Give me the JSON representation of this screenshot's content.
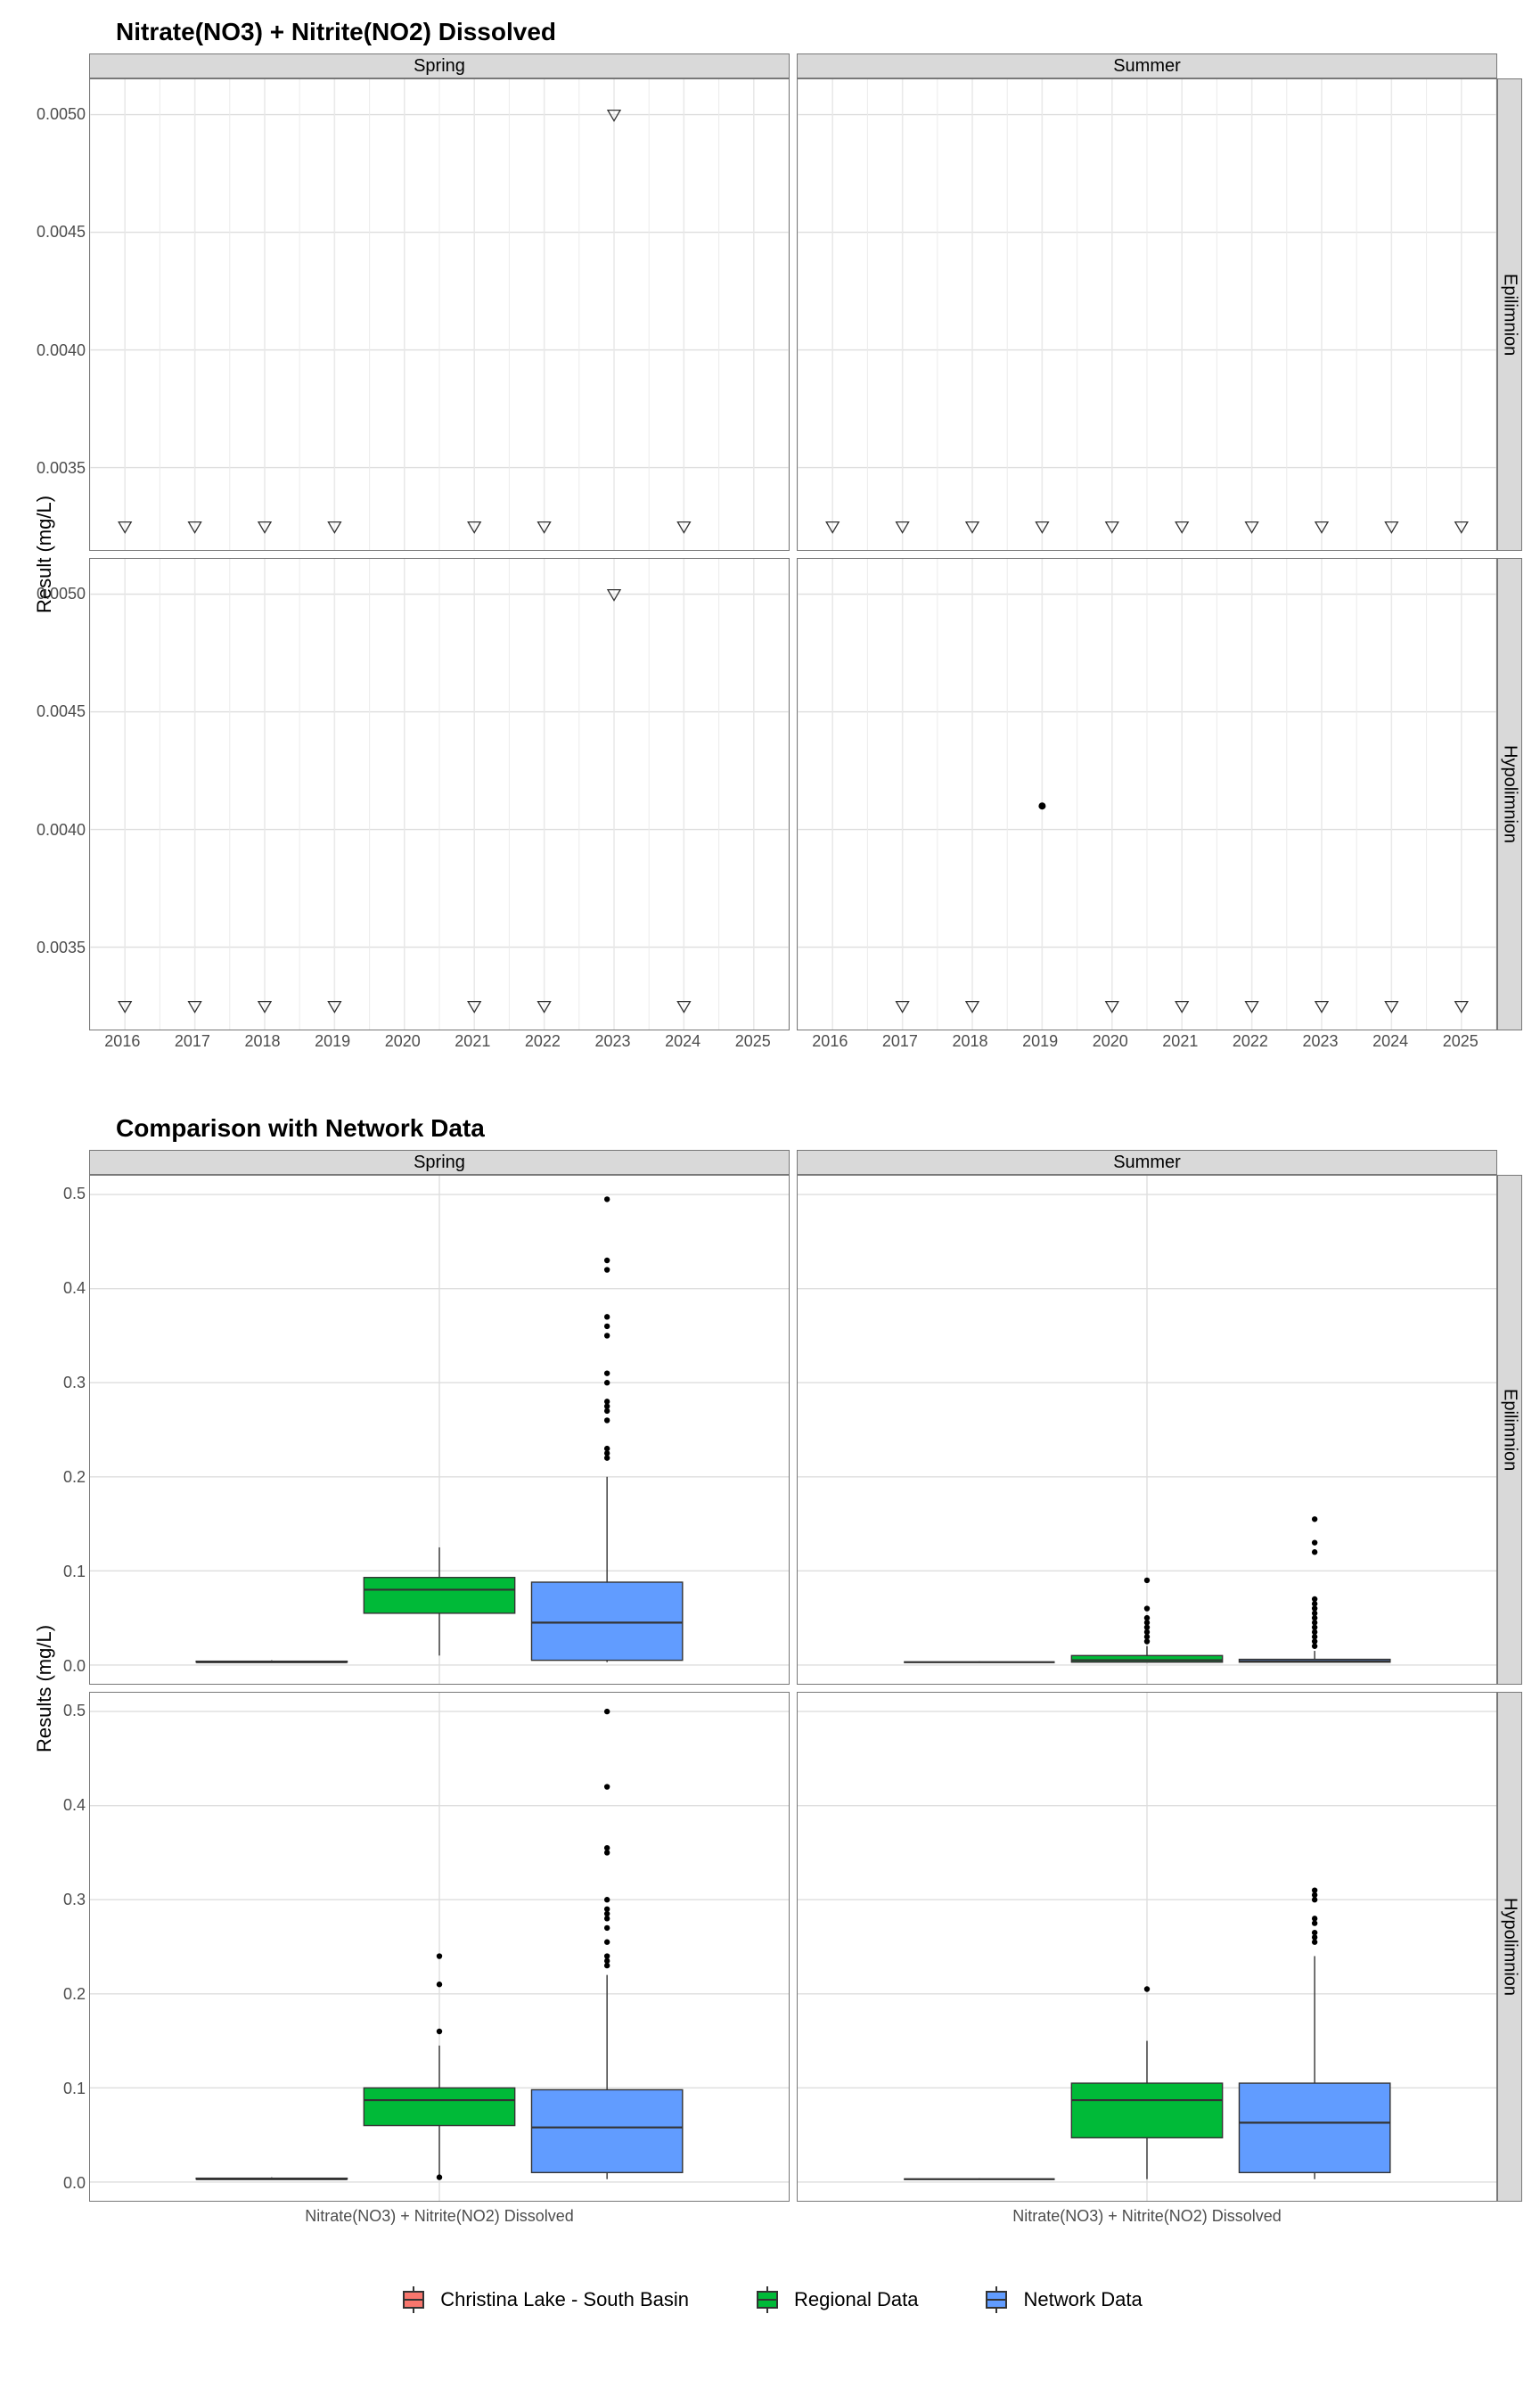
{
  "chart1": {
    "title": "Nitrate(NO3) + Nitrite(NO2) Dissolved",
    "ylab": "Result (mg/L)",
    "col_facets": [
      "Spring",
      "Summer"
    ],
    "row_facets": [
      "Epilimnion",
      "Hypolimnion"
    ],
    "x_ticks": [
      2016,
      2017,
      2018,
      2019,
      2020,
      2021,
      2022,
      2023,
      2024,
      2025
    ],
    "y_ticks": [
      0.0035,
      0.004,
      0.0045,
      0.005
    ],
    "ylim": [
      0.00315,
      0.00515
    ]
  },
  "chart2": {
    "title": "Comparison with Network Data",
    "ylab": "Results (mg/L)",
    "col_facets": [
      "Spring",
      "Summer"
    ],
    "row_facets": [
      "Epilimnion",
      "Hypolimnion"
    ],
    "y_ticks": [
      0.0,
      0.1,
      0.2,
      0.3,
      0.4,
      0.5
    ],
    "ylim": [
      -0.02,
      0.52
    ],
    "x_category": "Nitrate(NO3) + Nitrite(NO2) Dissolved"
  },
  "legend": {
    "items": [
      {
        "label": "Christina Lake - South Basin",
        "color": "#F8766D"
      },
      {
        "label": "Regional Data",
        "color": "#00BA38"
      },
      {
        "label": "Network Data",
        "color": "#619CFF"
      }
    ]
  },
  "chart_data": [
    {
      "type": "scatter",
      "title": "Nitrate(NO3) + Nitrite(NO2) Dissolved",
      "xlabel": "",
      "ylabel": "Result (mg/L)",
      "facets": {
        "columns": [
          "Spring",
          "Summer"
        ],
        "rows": [
          "Epilimnion",
          "Hypolimnion"
        ]
      },
      "ylim": [
        0.00315,
        0.00515
      ],
      "xlim": [
        2015.5,
        2025.5
      ],
      "panels": {
        "Spring|Epilimnion": {
          "censored_points": [
            {
              "x": 2016,
              "y": 0.00325
            },
            {
              "x": 2017,
              "y": 0.00325
            },
            {
              "x": 2018,
              "y": 0.00325
            },
            {
              "x": 2019,
              "y": 0.00325
            },
            {
              "x": 2021,
              "y": 0.00325
            },
            {
              "x": 2022,
              "y": 0.00325
            },
            {
              "x": 2023,
              "y": 0.005
            },
            {
              "x": 2024,
              "y": 0.00325
            }
          ],
          "points": []
        },
        "Summer|Epilimnion": {
          "censored_points": [
            {
              "x": 2016,
              "y": 0.00325
            },
            {
              "x": 2017,
              "y": 0.00325
            },
            {
              "x": 2018,
              "y": 0.00325
            },
            {
              "x": 2019,
              "y": 0.00325
            },
            {
              "x": 2020,
              "y": 0.00325
            },
            {
              "x": 2021,
              "y": 0.00325
            },
            {
              "x": 2022,
              "y": 0.00325
            },
            {
              "x": 2023,
              "y": 0.00325
            },
            {
              "x": 2024,
              "y": 0.00325
            },
            {
              "x": 2025,
              "y": 0.00325
            }
          ],
          "points": []
        },
        "Spring|Hypolimnion": {
          "censored_points": [
            {
              "x": 2016,
              "y": 0.00325
            },
            {
              "x": 2017,
              "y": 0.00325
            },
            {
              "x": 2018,
              "y": 0.00325
            },
            {
              "x": 2019,
              "y": 0.00325
            },
            {
              "x": 2021,
              "y": 0.00325
            },
            {
              "x": 2022,
              "y": 0.00325
            },
            {
              "x": 2023,
              "y": 0.005
            },
            {
              "x": 2024,
              "y": 0.00325
            }
          ],
          "points": []
        },
        "Summer|Hypolimnion": {
          "censored_points": [
            {
              "x": 2017,
              "y": 0.00325
            },
            {
              "x": 2018,
              "y": 0.00325
            },
            {
              "x": 2020,
              "y": 0.00325
            },
            {
              "x": 2021,
              "y": 0.00325
            },
            {
              "x": 2022,
              "y": 0.00325
            },
            {
              "x": 2023,
              "y": 0.00325
            },
            {
              "x": 2024,
              "y": 0.00325
            },
            {
              "x": 2025,
              "y": 0.00325
            }
          ],
          "points": [
            {
              "x": 2019,
              "y": 0.0041
            }
          ]
        }
      }
    },
    {
      "type": "box",
      "title": "Comparison with Network Data",
      "xlabel": "",
      "ylabel": "Results (mg/L)",
      "facets": {
        "columns": [
          "Spring",
          "Summer"
        ],
        "rows": [
          "Epilimnion",
          "Hypolimnion"
        ]
      },
      "ylim": [
        -0.02,
        0.52
      ],
      "x_categories": [
        "Nitrate(NO3) + Nitrite(NO2) Dissolved"
      ],
      "series_colors": {
        "Christina Lake - South Basin": "#F8766D",
        "Regional Data": "#00BA38",
        "Network Data": "#619CFF"
      },
      "panels": {
        "Spring|Epilimnion": {
          "boxes": [
            {
              "series": "Christina Lake - South Basin",
              "min": 0.003,
              "q1": 0.003,
              "median": 0.003,
              "q3": 0.004,
              "max": 0.005,
              "outliers": []
            },
            {
              "series": "Regional Data",
              "min": 0.01,
              "q1": 0.055,
              "median": 0.08,
              "q3": 0.093,
              "max": 0.125,
              "outliers": []
            },
            {
              "series": "Network Data",
              "min": 0.003,
              "q1": 0.005,
              "median": 0.045,
              "q3": 0.088,
              "max": 0.2,
              "outliers": [
                0.22,
                0.225,
                0.23,
                0.26,
                0.27,
                0.275,
                0.28,
                0.3,
                0.31,
                0.35,
                0.36,
                0.37,
                0.42,
                0.43,
                0.495
              ]
            }
          ]
        },
        "Summer|Epilimnion": {
          "boxes": [
            {
              "series": "Christina Lake - South Basin",
              "min": 0.003,
              "q1": 0.003,
              "median": 0.003,
              "q3": 0.003,
              "max": 0.004,
              "outliers": []
            },
            {
              "series": "Regional Data",
              "min": 0.003,
              "q1": 0.003,
              "median": 0.005,
              "q3": 0.01,
              "max": 0.02,
              "outliers": [
                0.025,
                0.03,
                0.035,
                0.04,
                0.045,
                0.05,
                0.06,
                0.09
              ]
            },
            {
              "series": "Network Data",
              "min": 0.003,
              "q1": 0.003,
              "median": 0.004,
              "q3": 0.006,
              "max": 0.015,
              "outliers": [
                0.02,
                0.025,
                0.03,
                0.035,
                0.04,
                0.045,
                0.05,
                0.055,
                0.06,
                0.065,
                0.07,
                0.12,
                0.13,
                0.155
              ]
            }
          ]
        },
        "Spring|Hypolimnion": {
          "boxes": [
            {
              "series": "Christina Lake - South Basin",
              "min": 0.003,
              "q1": 0.003,
              "median": 0.003,
              "q3": 0.004,
              "max": 0.005,
              "outliers": []
            },
            {
              "series": "Regional Data",
              "min": 0.003,
              "q1": 0.06,
              "median": 0.087,
              "q3": 0.1,
              "max": 0.145,
              "outliers": [
                0.005,
                0.16,
                0.21,
                0.24
              ]
            },
            {
              "series": "Network Data",
              "min": 0.003,
              "q1": 0.01,
              "median": 0.058,
              "q3": 0.098,
              "max": 0.22,
              "outliers": [
                0.23,
                0.235,
                0.24,
                0.255,
                0.27,
                0.28,
                0.285,
                0.29,
                0.3,
                0.35,
                0.355,
                0.42,
                0.5
              ]
            }
          ]
        },
        "Summer|Hypolimnion": {
          "boxes": [
            {
              "series": "Christina Lake - South Basin",
              "min": 0.003,
              "q1": 0.003,
              "median": 0.003,
              "q3": 0.003,
              "max": 0.004,
              "outliers": []
            },
            {
              "series": "Regional Data",
              "min": 0.003,
              "q1": 0.047,
              "median": 0.087,
              "q3": 0.105,
              "max": 0.15,
              "outliers": [
                0.205
              ]
            },
            {
              "series": "Network Data",
              "min": 0.003,
              "q1": 0.01,
              "median": 0.063,
              "q3": 0.105,
              "max": 0.24,
              "outliers": [
                0.255,
                0.26,
                0.265,
                0.275,
                0.28,
                0.3,
                0.305,
                0.31
              ]
            }
          ]
        }
      }
    }
  ]
}
